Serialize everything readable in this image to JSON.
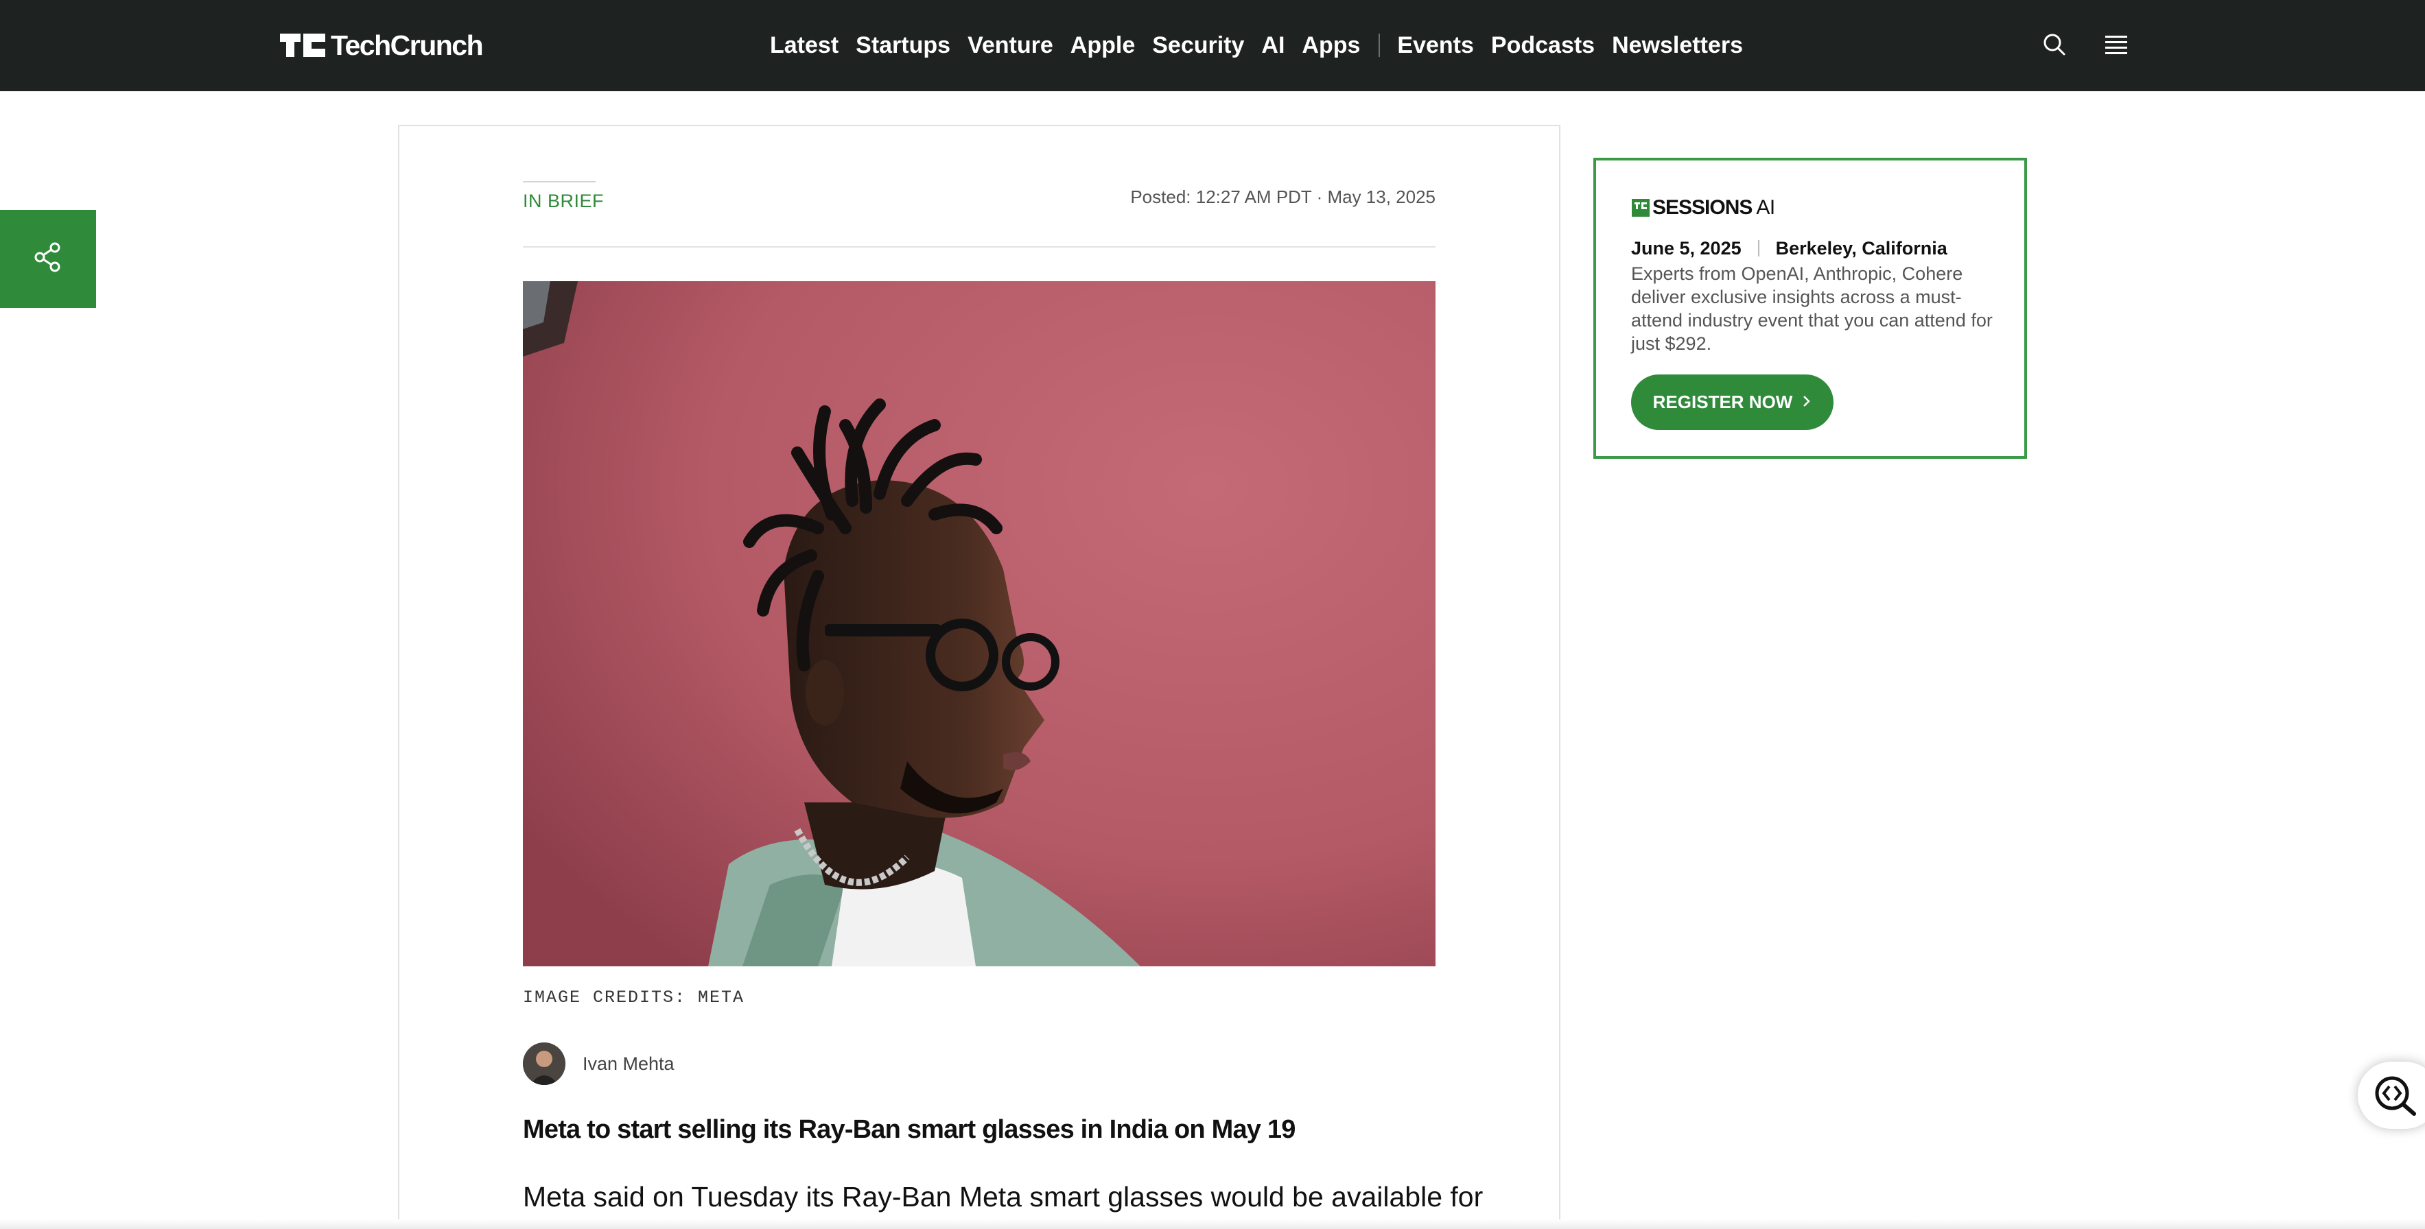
{
  "site": {
    "logo_text": "TechCrunch"
  },
  "nav": {
    "items": [
      {
        "label": "Latest"
      },
      {
        "label": "Startups"
      },
      {
        "label": "Venture"
      },
      {
        "label": "Apple"
      },
      {
        "label": "Security"
      },
      {
        "label": "AI"
      },
      {
        "label": "Apps"
      },
      {
        "label": "Events"
      },
      {
        "label": "Podcasts"
      },
      {
        "label": "Newsletters"
      }
    ],
    "icons": [
      "search-icon",
      "menu-icon"
    ]
  },
  "share": {
    "icon": "share-icon"
  },
  "article": {
    "kicker": "IN BRIEF",
    "posted": "Posted: 12:27 AM PDT · May 13, 2025",
    "image_credits": "IMAGE CREDITS: META",
    "author": "Ivan Mehta",
    "headline": "Meta to start selling its Ray-Ban smart glasses in India on May 19",
    "lede": "Meta said on Tuesday its Ray-Ban Meta smart glasses would be available for"
  },
  "promo": {
    "brand": "SESSIONS",
    "brand_suffix": "AI",
    "date": "June 5, 2025",
    "location": "Berkeley, California",
    "description": "Experts from OpenAI, Anthropic, Cohere deliver exclusive insights across a must-attend industry event that you can attend for just $292.",
    "button_label": "REGISTER NOW"
  },
  "colors": {
    "header_bg": "#1e2221",
    "accent_green": "#2f8a3a",
    "hero_bg": "#b45a66"
  },
  "widget": {
    "icon": "code-search-icon"
  }
}
